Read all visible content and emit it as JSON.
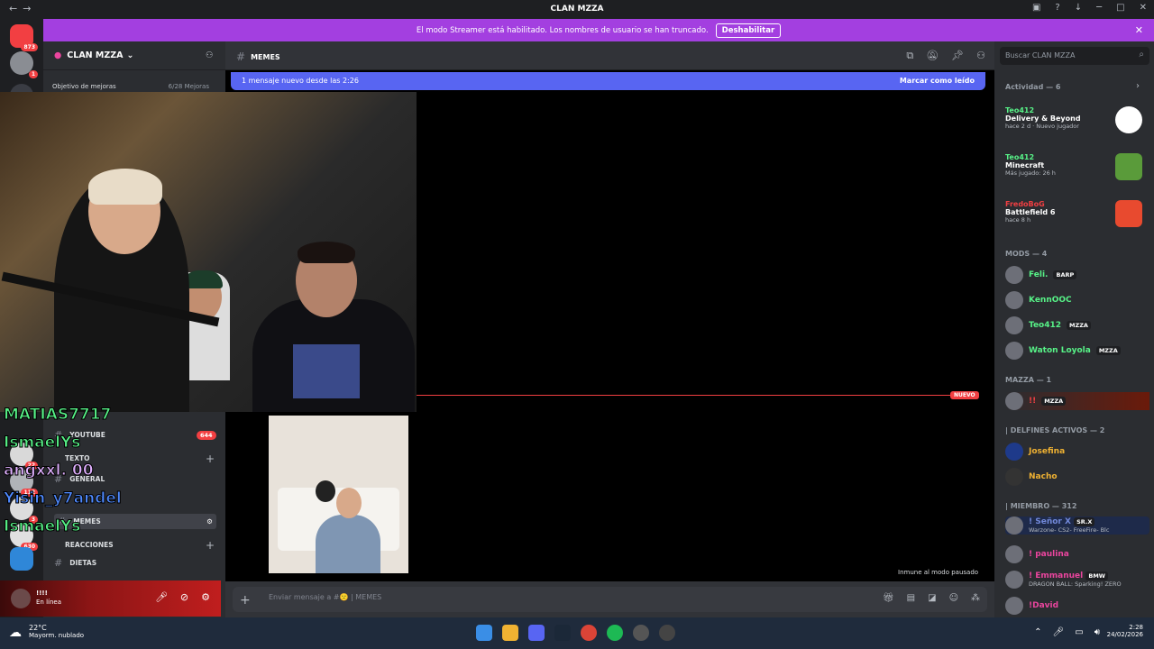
{
  "window": {
    "title": "CLAN MZZA"
  },
  "banner": {
    "text": "El modo Streamer está habilitado. Los nombres de usuario se han truncado.",
    "button": "Deshabilitar"
  },
  "server_badges": {
    "home": "873",
    "s2": "1"
  },
  "server_badges_overlay": [
    "22",
    "112",
    "3",
    "630"
  ],
  "guild": {
    "name": "CLAN MZZA",
    "goal_label": "Objetivo de mejoras",
    "goal_progress": "6/28 Mejoras"
  },
  "channels": {
    "rows": [
      {
        "label": "YOUTUBE",
        "badge": "644"
      },
      {
        "label": "GENERAL"
      },
      {
        "label": "MEMES"
      },
      {
        "label": "DIETAS"
      }
    ],
    "categories": {
      "texto": "TEXTO",
      "reacciones": "REACCIONES"
    }
  },
  "user_panel": {
    "name": "!!!!",
    "status": "En línea"
  },
  "channel_header": {
    "name": "MEMES"
  },
  "new_messages": {
    "text": "1 mensaje nuevo desde las 2:26",
    "action": "Marcar como leído"
  },
  "new_divider": "NUEVO",
  "immune_text": "Inmune al modo pausado",
  "composer": {
    "placeholder": "Enviar mensaje a #🙁 | MEMES"
  },
  "search": {
    "placeholder": "Buscar CLAN MZZA"
  },
  "activity": {
    "header": "Actividad — 6",
    "items": [
      {
        "who": "Teo412",
        "game": "Delivery & Beyond",
        "sub": "hace 2 d · Nuevo jugador",
        "color": "#ffffff"
      },
      {
        "who": "Teo412",
        "game": "Minecraft",
        "sub": "Más jugado: 26 h",
        "color": "#5a9b3a"
      },
      {
        "who": "FredoBoG",
        "game": "Battlefield 6",
        "sub": "hace 8 h",
        "color": "#e84a2f"
      }
    ]
  },
  "member_groups": [
    {
      "header": "MODS — 4",
      "members": [
        {
          "name": "Feli.",
          "tag": "BARP",
          "color": "#57f287"
        },
        {
          "name": "KennOOC",
          "tag": "",
          "color": "#57f287"
        },
        {
          "name": "Teo412",
          "tag": "MZZA",
          "color": "#57f287"
        },
        {
          "name": "Waton Loyola",
          "tag": "MZZA",
          "color": "#57f287"
        }
      ]
    },
    {
      "header": "MAZZA — 1",
      "members": [
        {
          "name": "!!",
          "tag": "MZZA",
          "color": "#f23f42"
        }
      ]
    },
    {
      "header": "| DELFINES ACTIVOS — 2",
      "members": [
        {
          "name": "Josefina",
          "tag": "",
          "color": "#f0b232"
        },
        {
          "name": "Nacho",
          "tag": "",
          "color": "#f0b232"
        }
      ]
    },
    {
      "header": "| MIEMBRO — 312",
      "members": [
        {
          "name": "! Señor X",
          "tag": "SR.X",
          "sub": "Warzone- CS2- FreeFire- Blc",
          "color": "#7289da"
        },
        {
          "name": "! paulina",
          "tag": "",
          "color": "#eb459e"
        },
        {
          "name": "! Emmanuel",
          "tag": "BMW",
          "sub": "DRAGON BALL: Sparking! ZERO",
          "color": "#eb459e"
        },
        {
          "name": "!David",
          "tag": "",
          "color": "#eb459e"
        }
      ]
    }
  ],
  "overlay_chat": [
    {
      "name": "MATIAS7717",
      "color": "#57f287"
    },
    {
      "name": "IsmaelYs",
      "color": "#57f287"
    },
    {
      "name": "angxxl. 00",
      "color": "#e0b0ff"
    },
    {
      "name": "Yisin_y7andel",
      "color": "#4f8aff"
    },
    {
      "name": "IsmaelYs",
      "color": "#57f287"
    }
  ],
  "taskbar": {
    "temp": "22°C",
    "weather": "Mayorm. nublado",
    "time": "2:28",
    "date": "24/02/2026"
  }
}
